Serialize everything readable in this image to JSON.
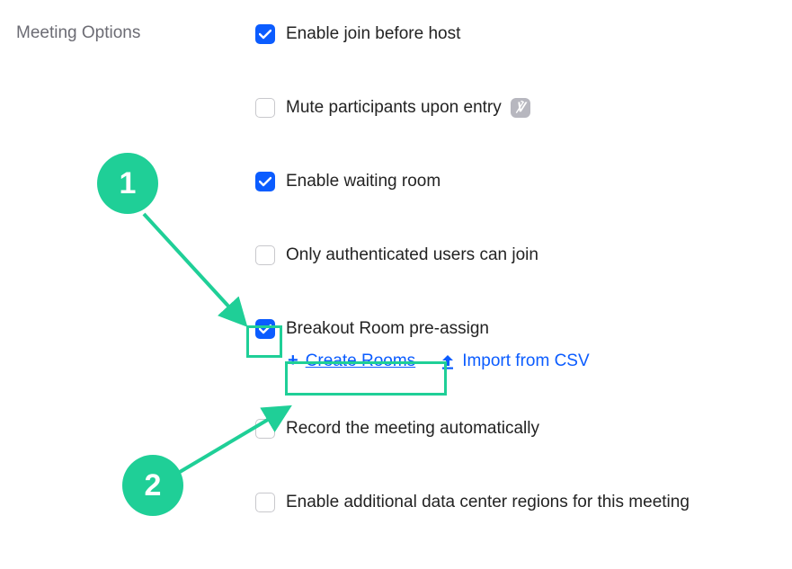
{
  "section_label": "Meeting Options",
  "options": {
    "join_before_host": {
      "label": "Enable join before host",
      "checked": true
    },
    "mute_on_entry": {
      "label": "Mute participants upon entry",
      "checked": false
    },
    "waiting_room": {
      "label": "Enable waiting room",
      "checked": true
    },
    "auth_only": {
      "label": "Only authenticated users can join",
      "checked": false
    },
    "breakout_preassign": {
      "label": "Breakout Room pre-assign",
      "checked": true
    },
    "auto_record": {
      "label": "Record the meeting automatically",
      "checked": false
    },
    "data_center_regions": {
      "label": "Enable additional data center regions for this meeting",
      "checked": false
    }
  },
  "breakout_actions": {
    "create_rooms": "Create Rooms",
    "import_csv": "Import from CSV"
  },
  "annotations": {
    "step1": "1",
    "step2": "2"
  },
  "colors": {
    "accent_blue": "#0b5cff",
    "highlight_green": "#1fcf97"
  }
}
